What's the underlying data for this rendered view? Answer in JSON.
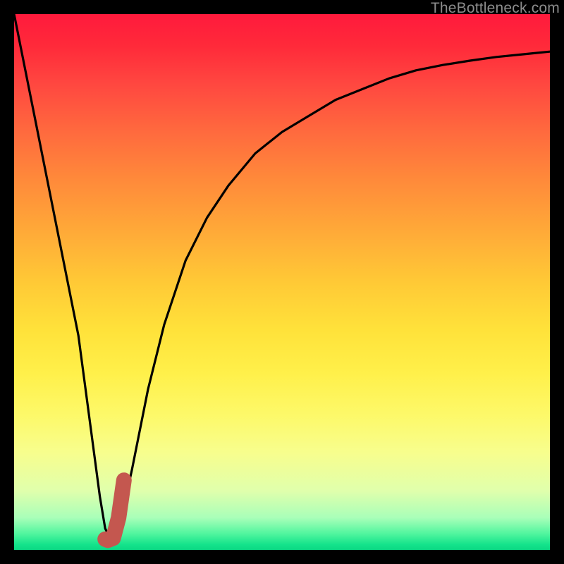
{
  "watermark": "TheBottleneck.com",
  "colors": {
    "background": "#000000",
    "curve": "#000000",
    "highlight": "#c4574f",
    "gradient_top": "#ff1a3c",
    "gradient_bottom": "#0bd884"
  },
  "chart_data": {
    "type": "line",
    "title": "",
    "xlabel": "",
    "ylabel": "",
    "xlim": [
      0,
      100
    ],
    "ylim": [
      0,
      100
    ],
    "grid": false,
    "legend": false,
    "series": [
      {
        "name": "bottleneck-curve",
        "x": [
          0,
          4,
          8,
          12,
          14,
          16,
          17,
          18,
          20,
          22,
          25,
          28,
          32,
          36,
          40,
          45,
          50,
          55,
          60,
          65,
          70,
          75,
          80,
          85,
          90,
          95,
          100
        ],
        "y": [
          100,
          80,
          60,
          40,
          25,
          10,
          4,
          2,
          6,
          15,
          30,
          42,
          54,
          62,
          68,
          74,
          78,
          81,
          84,
          86,
          88,
          89.5,
          90.5,
          91.3,
          92,
          92.5,
          93
        ]
      },
      {
        "name": "highlight-segment",
        "x": [
          17.0,
          17.5,
          18.5,
          19.5,
          20.5
        ],
        "y": [
          2.0,
          1.8,
          2.2,
          6.0,
          13.0
        ]
      }
    ]
  }
}
